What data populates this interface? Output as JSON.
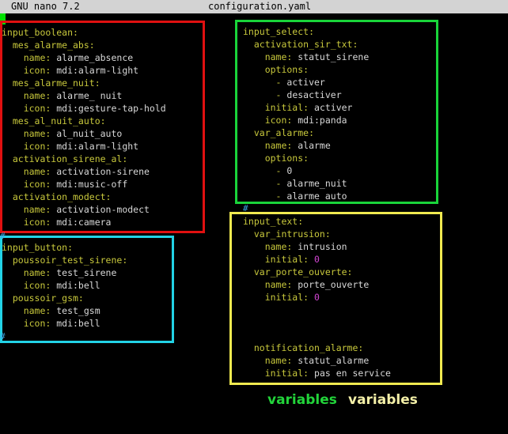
{
  "titlebar": {
    "app": "GNU nano 7.2",
    "filename": "configuration.yaml"
  },
  "colors": {
    "titlebar_bg": "#d3d3d3",
    "cursor": "#00e000",
    "key": "#c8c83c",
    "value": "#d8d8d8",
    "number": "#d346d3",
    "red_box": "#e01010",
    "green_box": "#19d43a",
    "cyan_box": "#22d3e6",
    "yellow_box": "#f0ea50",
    "label_green": "#22d43a",
    "label_yellow": "#f4f0a8"
  },
  "comment_marker": "#",
  "panels": {
    "input_boolean": [
      {
        "key": "input_boolean:",
        "value": ""
      },
      {
        "key": "  mes_alarme_abs:",
        "value": ""
      },
      {
        "key": "    name:",
        "value": " alarme_absence"
      },
      {
        "key": "    icon:",
        "value": " mdi:alarm-light"
      },
      {
        "key": "  mes_alarme_nuit:",
        "value": ""
      },
      {
        "key": "    name:",
        "value": " alarme_ nuit"
      },
      {
        "key": "    icon:",
        "value": " mdi:gesture-tap-hold"
      },
      {
        "key": "  mes_al_nuit_auto:",
        "value": ""
      },
      {
        "key": "    name:",
        "value": " al_nuit_auto"
      },
      {
        "key": "    icon:",
        "value": " mdi:alarm-light"
      },
      {
        "key": "  activation_sirene_al:",
        "value": ""
      },
      {
        "key": "    name:",
        "value": " activation-sirene"
      },
      {
        "key": "    icon:",
        "value": " mdi:music-off"
      },
      {
        "key": "  activation_modect:",
        "value": ""
      },
      {
        "key": "    name:",
        "value": " activation-modect"
      },
      {
        "key": "    icon:",
        "value": " mdi:camera"
      }
    ],
    "input_button": [
      {
        "key": "input_button:",
        "value": ""
      },
      {
        "key": "  poussoir_test_sirene:",
        "value": ""
      },
      {
        "key": "    name:",
        "value": " test_sirene"
      },
      {
        "key": "    icon:",
        "value": " mdi:bell"
      },
      {
        "key": "  poussoir_gsm:",
        "value": ""
      },
      {
        "key": "    name:",
        "value": " test_gsm"
      },
      {
        "key": "    icon:",
        "value": " mdi:bell"
      }
    ],
    "input_select": [
      {
        "key": "input_select:",
        "value": ""
      },
      {
        "key": "  activation_sir_txt:",
        "value": ""
      },
      {
        "key": "    name:",
        "value": " statut_sirene"
      },
      {
        "key": "    options:",
        "value": ""
      },
      {
        "key": "      - ",
        "value": "activer"
      },
      {
        "key": "      - ",
        "value": "desactiver"
      },
      {
        "key": "    initial:",
        "value": " activer"
      },
      {
        "key": "    icon:",
        "value": " mdi:panda"
      },
      {
        "key": "  var_alarme:",
        "value": ""
      },
      {
        "key": "    name:",
        "value": " alarme"
      },
      {
        "key": "    options:",
        "value": ""
      },
      {
        "key": "      - ",
        "value": "0"
      },
      {
        "key": "      - ",
        "value": "alarme_nuit"
      },
      {
        "key": "      - ",
        "value": "alarme auto"
      }
    ],
    "input_text": [
      {
        "key": "input_text:",
        "value": ""
      },
      {
        "key": "  var_intrusion:",
        "value": ""
      },
      {
        "key": "    name:",
        "value": " intrusion"
      },
      {
        "key": "    initial:",
        "value": " ",
        "number": "0"
      },
      {
        "key": "  var_porte_ouverte:",
        "value": ""
      },
      {
        "key": "    name:",
        "value": " porte_ouverte"
      },
      {
        "key": "    initial:",
        "value": " ",
        "number": "0"
      },
      {
        "key": "",
        "value": ""
      },
      {
        "key": "",
        "value": ""
      },
      {
        "key": "",
        "value": ""
      },
      {
        "key": "  notification_alarme:",
        "value": ""
      },
      {
        "key": "    name:",
        "value": " statut_alarme"
      },
      {
        "key": "    initial:",
        "value": " pas en service"
      }
    ]
  },
  "labels": {
    "green": "variables",
    "yellow": "variables"
  }
}
